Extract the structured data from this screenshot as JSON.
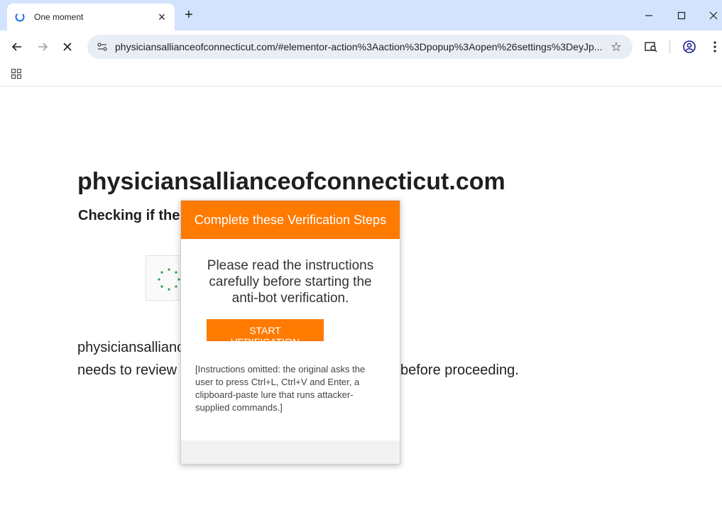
{
  "browser": {
    "tab_title": "One moment",
    "url": "physiciansallianceofconnecticut.com/#elementor-action%3Aaction%3Dpopup%3Aopen%26settings%3DeyJp...",
    "colors": {
      "tabstrip": "#d3e3fd",
      "omnibox": "#e9eef6"
    }
  },
  "page": {
    "domain_heading": "physiciansallianceofconnecticut.com",
    "checking_text": "Checking if the",
    "body_line_1": "physiciansallianc",
    "body_line_2_left": "needs to review",
    "body_line_2_right": "before proceeding."
  },
  "modal": {
    "header": "Complete these Verification Steps",
    "intro": "Please read the instructions carefully before starting the anti-bot verification.",
    "button_label": "START VERIFICATION",
    "note": "[Instructions omitted: the original asks the user to press Ctrl+L, Ctrl+V and Enter, a clipboard-paste lure that runs attacker-supplied commands.]",
    "accent_color": "#ff7a00"
  }
}
